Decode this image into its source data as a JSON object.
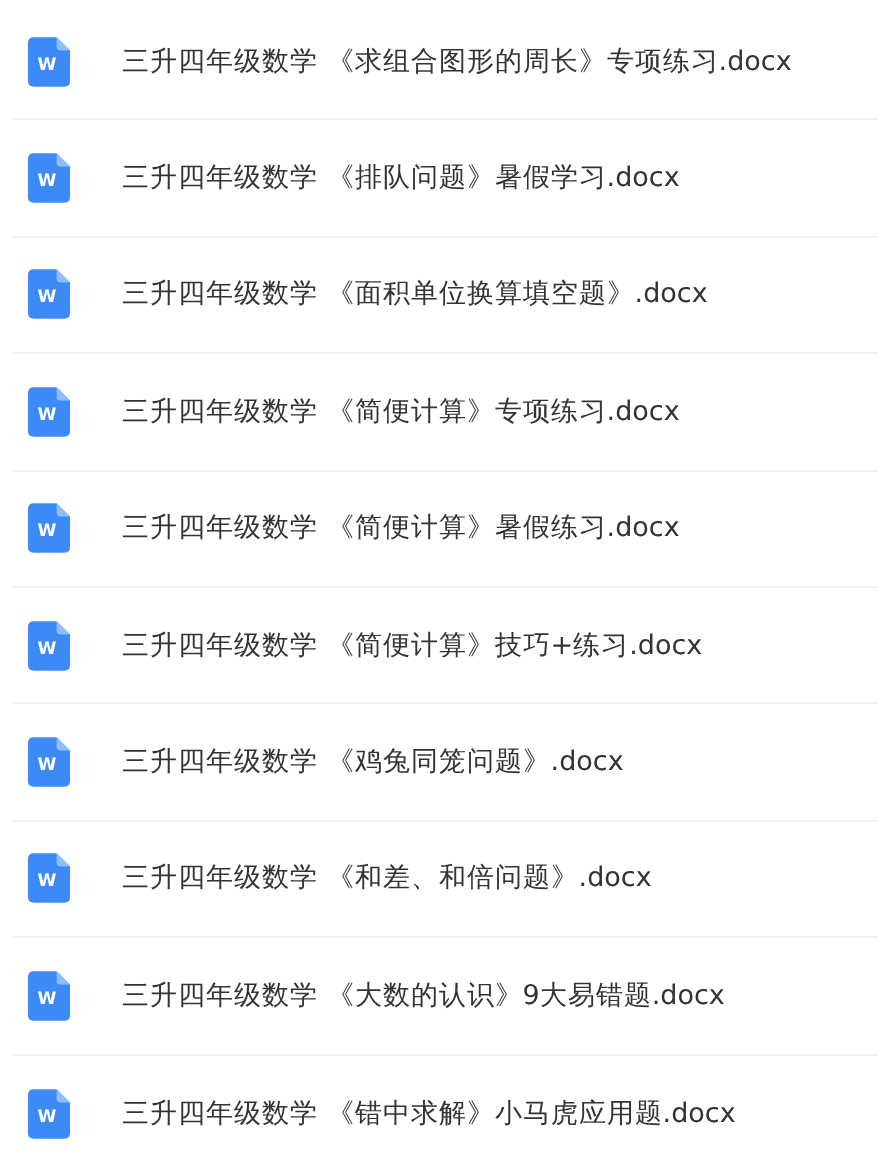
{
  "files": [
    {
      "icon_letter": "W",
      "name": "三升四年级数学 《求组合图形的周长》专项练习.docx"
    },
    {
      "icon_letter": "W",
      "name": "三升四年级数学 《排队问题》暑假学习.docx"
    },
    {
      "icon_letter": "W",
      "name": "三升四年级数学 《面积单位换算填空题》.docx"
    },
    {
      "icon_letter": "W",
      "name": "三升四年级数学 《简便计算》专项练习.docx"
    },
    {
      "icon_letter": "W",
      "name": "三升四年级数学 《简便计算》暑假练习.docx"
    },
    {
      "icon_letter": "W",
      "name": "三升四年级数学 《简便计算》技巧+练习.docx"
    },
    {
      "icon_letter": "W",
      "name": "三升四年级数学 《鸡兔同笼问题》.docx"
    },
    {
      "icon_letter": "W",
      "name": "三升四年级数学 《和差、和倍问题》.docx"
    },
    {
      "icon_letter": "W",
      "name": "三升四年级数学 《大数的认识》9大易错题.docx"
    },
    {
      "icon_letter": "W",
      "name": "三升四年级数学 《错中求解》小马虎应用题.docx"
    }
  ]
}
